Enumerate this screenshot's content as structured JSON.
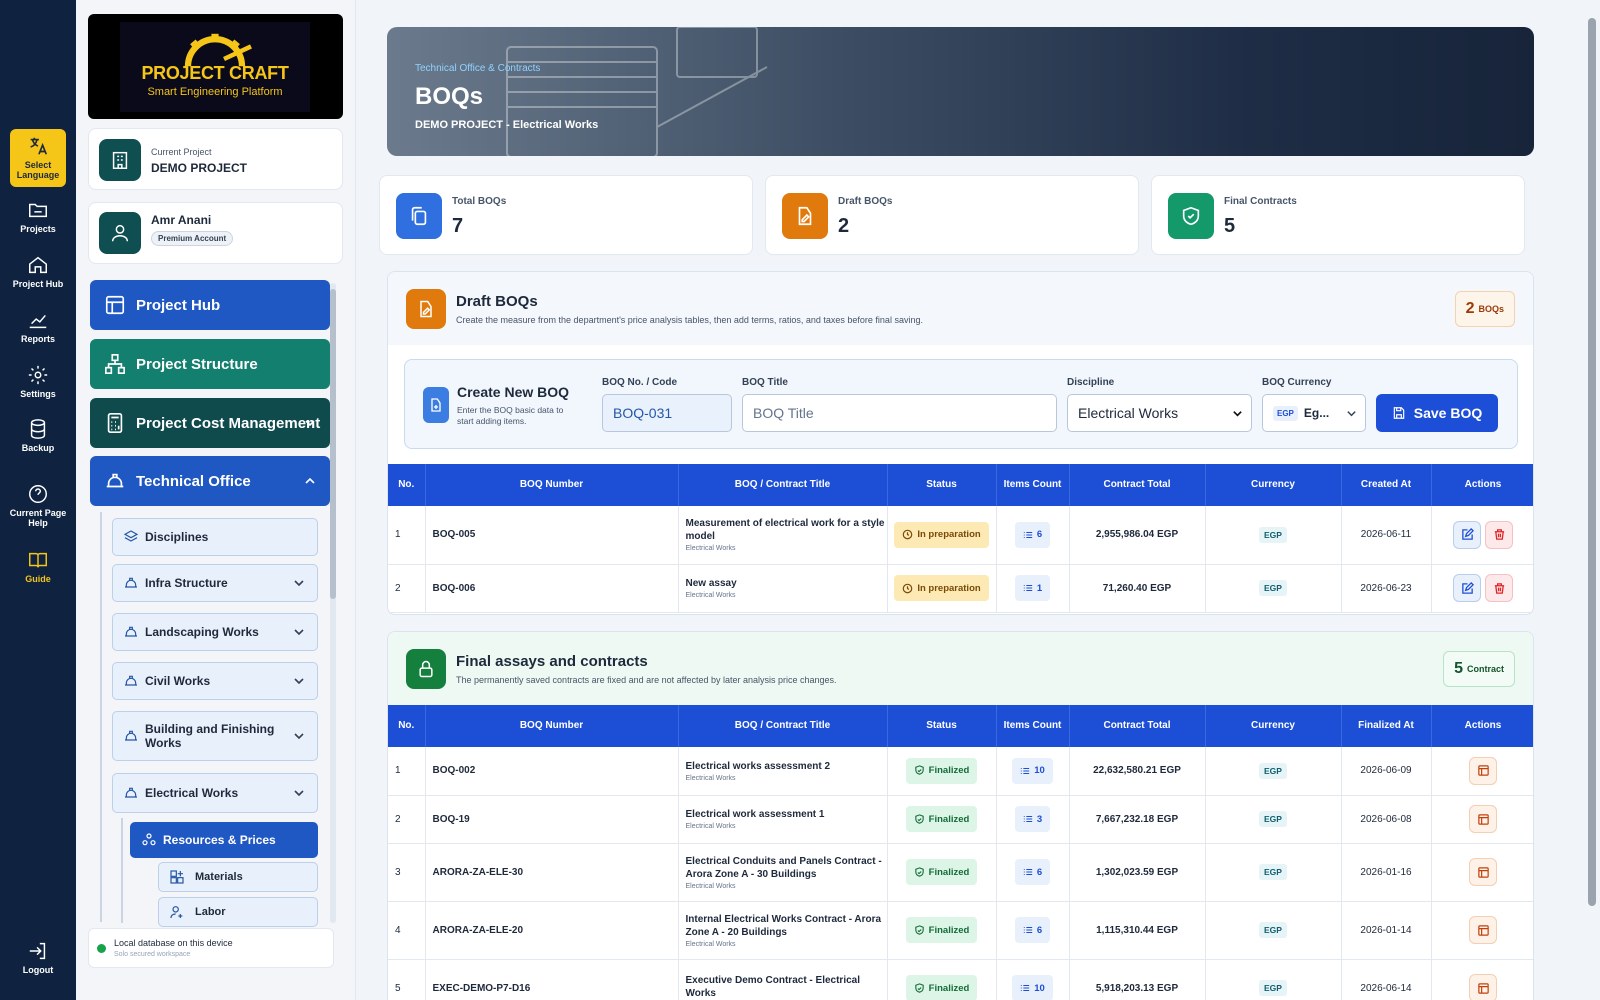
{
  "rail": {
    "items": [
      {
        "label": "Select Language",
        "icon": "translate-icon"
      },
      {
        "label": "Projects",
        "icon": "folder-icon"
      },
      {
        "label": "Project Hub",
        "icon": "home-icon"
      },
      {
        "label": "Reports",
        "icon": "chart-icon"
      },
      {
        "label": "Settings",
        "icon": "gear-icon"
      },
      {
        "label": "Backup",
        "icon": "database-icon"
      },
      {
        "label": "Current Page Help",
        "icon": "help-icon"
      },
      {
        "label": "Guide",
        "icon": "book-icon"
      },
      {
        "label": "Logout",
        "icon": "logout-icon"
      }
    ]
  },
  "sidebar": {
    "logo": {
      "title": "PROJECT CRAFT",
      "subtitle": "Smart Engineering Platform"
    },
    "project": {
      "label": "Current Project",
      "name": "DEMO PROJECT"
    },
    "user": {
      "name": "Amr Anani",
      "badge": "Premium Account"
    },
    "nav": [
      {
        "label": "Project Hub",
        "color": "#1f57c3"
      },
      {
        "label": "Project Structure",
        "color": "#137f6e"
      },
      {
        "label": "Project Cost Management",
        "color": "#0f4a4d"
      },
      {
        "label": "Technical Office",
        "color": "#1f57c3"
      }
    ],
    "sub": [
      "Disciplines",
      "Infra Structure",
      "Landscaping Works",
      "Civil Works",
      "Building and Finishing Works",
      "Electrical Works"
    ],
    "resources": "Resources & Prices",
    "leaf": [
      "Materials",
      "Labor"
    ],
    "db": {
      "title": "Local database on this device",
      "sub": "Solo secured workspace"
    }
  },
  "hero": {
    "kicker": "Technical Office & Contracts",
    "title": "BOQs",
    "sub": "DEMO PROJECT - Electrical Works"
  },
  "stats": [
    {
      "label": "Total BOQs",
      "value": "7",
      "color": "#2f6fe0"
    },
    {
      "label": "Draft BOQs",
      "value": "2",
      "color": "#e07a0c"
    },
    {
      "label": "Final Contracts",
      "value": "5",
      "color": "#13996a"
    }
  ],
  "draft": {
    "title": "Draft BOQs",
    "sub": "Create the measure from the department's price analysis tables, then add terms, ratios, and taxes before final saving.",
    "badge_n": "2",
    "badge_u": "BOQs",
    "create": {
      "title": "Create New BOQ",
      "sub": "Enter the BOQ basic data to start adding items.",
      "code_label": "BOQ No. / Code",
      "code_value": "BOQ-031",
      "title_label": "BOQ Title",
      "title_placeholder": "BOQ Title",
      "disc_label": "Discipline",
      "disc_value": "Electrical Works",
      "cur_label": "BOQ Currency",
      "cur_chip": "EGP",
      "cur_value": "Eg...",
      "save": "Save BOQ"
    },
    "headers": [
      "No.",
      "BOQ Number",
      "BOQ / Contract Title",
      "Status",
      "Items Count",
      "Contract Total",
      "Currency",
      "Created At",
      "Actions"
    ],
    "rows": [
      {
        "no": "1",
        "num": "BOQ-005",
        "title": "Measurement of electrical work for a style model",
        "disc": "Electrical Works",
        "status": "In preparation",
        "count": "6",
        "total": "2,955,986.04 EGP",
        "cur": "EGP",
        "date": "2026-06-11"
      },
      {
        "no": "2",
        "num": "BOQ-006",
        "title": "New assay",
        "disc": "Electrical Works",
        "status": "In preparation",
        "count": "1",
        "total": "71,260.40 EGP",
        "cur": "EGP",
        "date": "2026-06-23"
      }
    ]
  },
  "final": {
    "title": "Final assays and contracts",
    "sub": "The permanently saved contracts are fixed and are not affected by later analysis price changes.",
    "badge_n": "5",
    "badge_u": "Contract",
    "headers": [
      "No.",
      "BOQ Number",
      "BOQ / Contract Title",
      "Status",
      "Items Count",
      "Contract Total",
      "Currency",
      "Finalized At",
      "Actions"
    ],
    "rows": [
      {
        "no": "1",
        "num": "BOQ-002",
        "title": "Electrical works assessment 2",
        "disc": "Electrical Works",
        "status": "Finalized",
        "count": "10",
        "total": "22,632,580.21 EGP",
        "cur": "EGP",
        "date": "2026-06-09"
      },
      {
        "no": "2",
        "num": "BOQ-19",
        "title": "Electrical work assessment 1",
        "disc": "Electrical Works",
        "status": "Finalized",
        "count": "3",
        "total": "7,667,232.18 EGP",
        "cur": "EGP",
        "date": "2026-06-08"
      },
      {
        "no": "3",
        "num": "ARORA-ZA-ELE-30",
        "title": "Electrical Conduits and Panels Contract - Arora Zone A - 30 Buildings",
        "disc": "Electrical Works",
        "status": "Finalized",
        "count": "6",
        "total": "1,302,023.59 EGP",
        "cur": "EGP",
        "date": "2026-01-16"
      },
      {
        "no": "4",
        "num": "ARORA-ZA-ELE-20",
        "title": "Internal Electrical Works Contract - Arora Zone A - 20 Buildings",
        "disc": "Electrical Works",
        "status": "Finalized",
        "count": "6",
        "total": "1,115,310.44 EGP",
        "cur": "EGP",
        "date": "2026-01-14"
      },
      {
        "no": "5",
        "num": "EXEC-DEMO-P7-D16",
        "title": "Executive Demo Contract - Electrical Works",
        "disc": "",
        "status": "Finalized",
        "count": "10",
        "total": "5,918,203.13 EGP",
        "cur": "EGP",
        "date": "2026-06-14"
      }
    ]
  }
}
